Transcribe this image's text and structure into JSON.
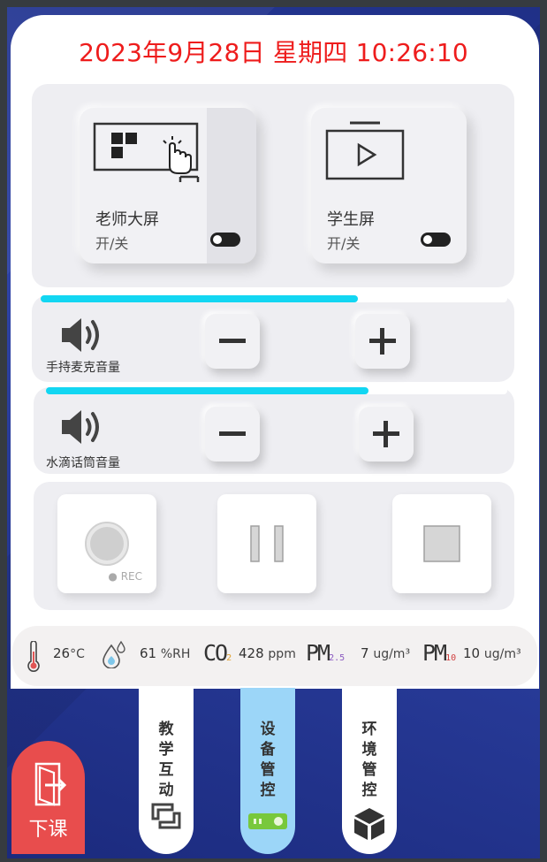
{
  "header": {
    "datetime": "2023年9月28日 星期四 10:26:10"
  },
  "screens": [
    {
      "title": "老师大屏",
      "state_label": "开/关"
    },
    {
      "title": "学生屏",
      "state_label": "开/关"
    }
  ],
  "volumes": [
    {
      "label": "手持麦克音量",
      "level": 0.68
    },
    {
      "label": "水滴话筒音量",
      "level": 0.7
    }
  ],
  "recording": {
    "rec_label": "● REC"
  },
  "environment": {
    "temperature": "26",
    "temperature_unit": "°C",
    "humidity": "61",
    "humidity_unit": "%RH",
    "co2_label_main": "CO",
    "co2_label_sub": "2",
    "co2": "428",
    "co2_unit": "ppm",
    "pm25_label_main": "PM",
    "pm25_label_sub": "2.5",
    "pm25": "7",
    "pm25_unit": "ug/m³",
    "pm10_label_main": "PM",
    "pm10_label_sub": "10",
    "pm10": "10",
    "pm10_unit": "ug/m³"
  },
  "nav": {
    "tabs": [
      {
        "label": "教学互动",
        "active": false
      },
      {
        "label": "设备管控",
        "active": true
      },
      {
        "label": "环境管控",
        "active": false
      }
    ],
    "exit_label": "下课"
  },
  "colors": {
    "datetime": "#ee1c1c",
    "volume_bar": "#12d6f2",
    "active_tab": "#9cd6f8",
    "exit_button": "#e84d4d",
    "background": "#2a3a92"
  }
}
